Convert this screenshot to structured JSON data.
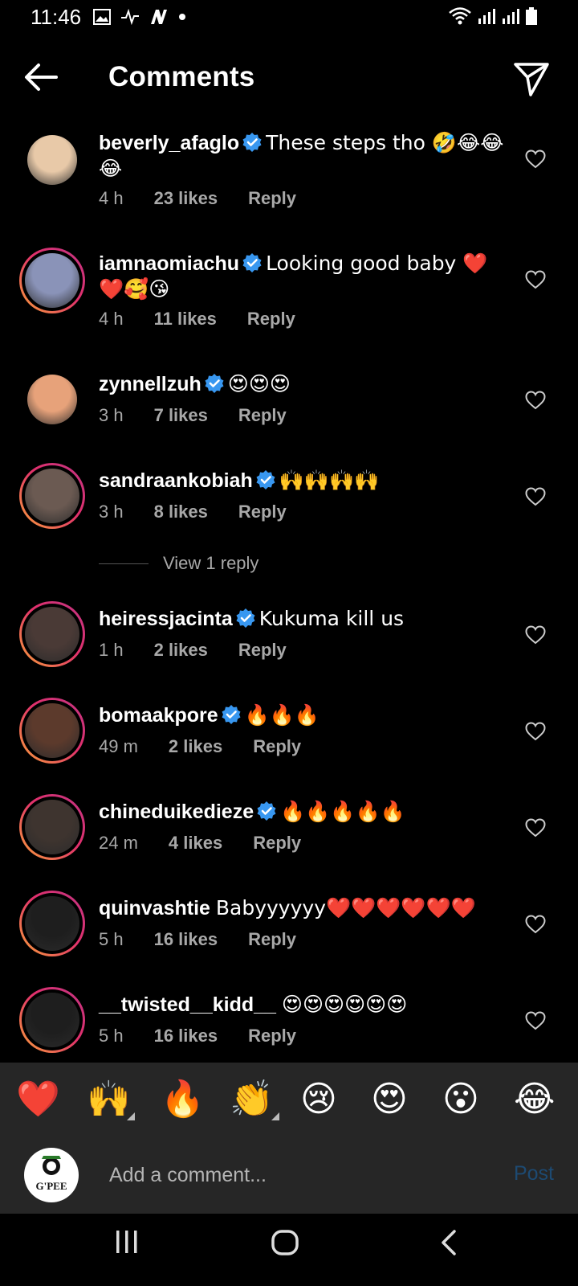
{
  "status_bar": {
    "time": "11:46",
    "left_icons": [
      "image-icon",
      "activity-icon",
      "n-icon",
      "dot-icon"
    ],
    "right_icons": [
      "wifi-icon",
      "signal-icon",
      "signal-icon",
      "battery-icon"
    ]
  },
  "header": {
    "title": "Comments",
    "back_icon": "arrow-left-icon",
    "share_icon": "send-icon"
  },
  "comments": [
    {
      "username": "beverly_afaglo",
      "verified": true,
      "text": "These steps tho 🤣😂😂😂",
      "time": "4 h",
      "likes": "23 likes",
      "reply": "Reply",
      "avatar_color": "#e8c9a8",
      "ring": false
    },
    {
      "username": "iamnaomiachu",
      "verified": true,
      "text": "Looking good baby ❤️❤️🥰😘",
      "time": "4 h",
      "likes": "11 likes",
      "reply": "Reply",
      "avatar_color": "#8a93b8",
      "ring": true
    },
    {
      "username": "zynnellzuh",
      "verified": true,
      "text": "😍😍😍",
      "time": "3 h",
      "likes": "7 likes",
      "reply": "Reply",
      "avatar_color": "#e7a27a",
      "ring": false
    },
    {
      "username": "sandraankobiah",
      "verified": true,
      "text": "🙌🙌🙌🙌",
      "time": "3 h",
      "likes": "8 likes",
      "reply": "Reply",
      "avatar_color": "#6b5a52",
      "ring": true
    },
    {
      "username": "heiressjacinta",
      "verified": true,
      "text": "Kukuma kill us",
      "time": "1 h",
      "likes": "2 likes",
      "reply": "Reply",
      "avatar_color": "#4a3a36",
      "ring": true
    },
    {
      "username": "bomaakpore",
      "verified": true,
      "text": "🔥🔥🔥",
      "time": "49 m",
      "likes": "2 likes",
      "reply": "Reply",
      "avatar_color": "#5c3a2c",
      "ring": true
    },
    {
      "username": "chineduikedieze",
      "verified": true,
      "text": "🔥🔥🔥🔥🔥",
      "time": "24 m",
      "likes": "4 likes",
      "reply": "Reply",
      "avatar_color": "#3e342f",
      "ring": true
    },
    {
      "username": "quinvashtie",
      "verified": false,
      "text": "Babyyyyyy❤️❤️❤️❤️❤️❤️",
      "time": "5 h",
      "likes": "16 likes",
      "reply": "Reply",
      "avatar_color": "#1e1e1e",
      "ring": true
    },
    {
      "username": "__twisted__kidd__",
      "verified": false,
      "text": "😍😍😍😍😍😍",
      "time": "5 h",
      "likes": "16 likes",
      "reply": "Reply",
      "avatar_color": "#1e1e1e",
      "ring": true
    }
  ],
  "view_replies": "View 1 reply",
  "quick_emojis": [
    "❤️",
    "🙌",
    "🔥",
    "👏",
    "😢",
    "😍",
    "😮",
    "😂"
  ],
  "composer": {
    "placeholder": "Add a comment...",
    "post_label": "Post",
    "avatar_text": "G'PEE"
  },
  "nav_bar": [
    "recent-apps-icon",
    "home-icon",
    "back-icon"
  ],
  "colors": {
    "verified": "#3897f0",
    "meta_text": "#a8a8a8",
    "post_disabled": "#1d4a72",
    "panel_bg": "#262626"
  }
}
